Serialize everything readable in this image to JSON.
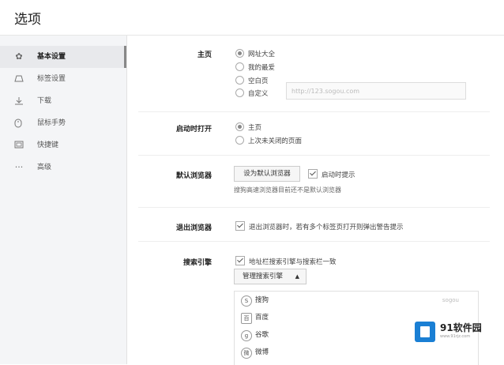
{
  "window": {
    "title": "选项"
  },
  "sidebar": {
    "items": [
      {
        "label": "基本设置",
        "icon": "gear-icon",
        "active": true
      },
      {
        "label": "标签设置",
        "icon": "tab-icon"
      },
      {
        "label": "下载",
        "icon": "download-icon"
      },
      {
        "label": "鼠标手势",
        "icon": "mouse-icon"
      },
      {
        "label": "快捷键",
        "icon": "keyboard-icon"
      },
      {
        "label": "高级",
        "icon": "more-icon"
      }
    ]
  },
  "homepage": {
    "label": "主页",
    "options": [
      "网址大全",
      "我的最爱",
      "空白页",
      "自定义"
    ],
    "selected": "网址大全",
    "custom_url": "http://123.sogou.com"
  },
  "startup": {
    "label": "启动时打开",
    "options": [
      "主页",
      "上次未关闭的页面"
    ],
    "selected": "主页"
  },
  "default_browser": {
    "label": "默认浏览器",
    "button": "设为默认浏览器",
    "check_label": "启动时提示",
    "note": "搜狗高速浏览器目前还不是默认浏览器"
  },
  "exit_browser": {
    "label": "退出浏览器",
    "check_label": "退出浏览器时，若有多个标签页打开则弹出警告提示"
  },
  "search_engine": {
    "label": "搜索引擎",
    "check_label": "地址栏搜索引擎与搜索栏一致",
    "manage_button": "管理搜索引擎",
    "engines": [
      {
        "name": "搜狗",
        "aux": "sogou"
      },
      {
        "name": "百度",
        "aux": ""
      },
      {
        "name": "谷歌",
        "aux": ""
      },
      {
        "name": "微博",
        "aux": ""
      }
    ]
  },
  "watermark": {
    "text": "91软件园",
    "sub": "www.91rjz.com"
  }
}
